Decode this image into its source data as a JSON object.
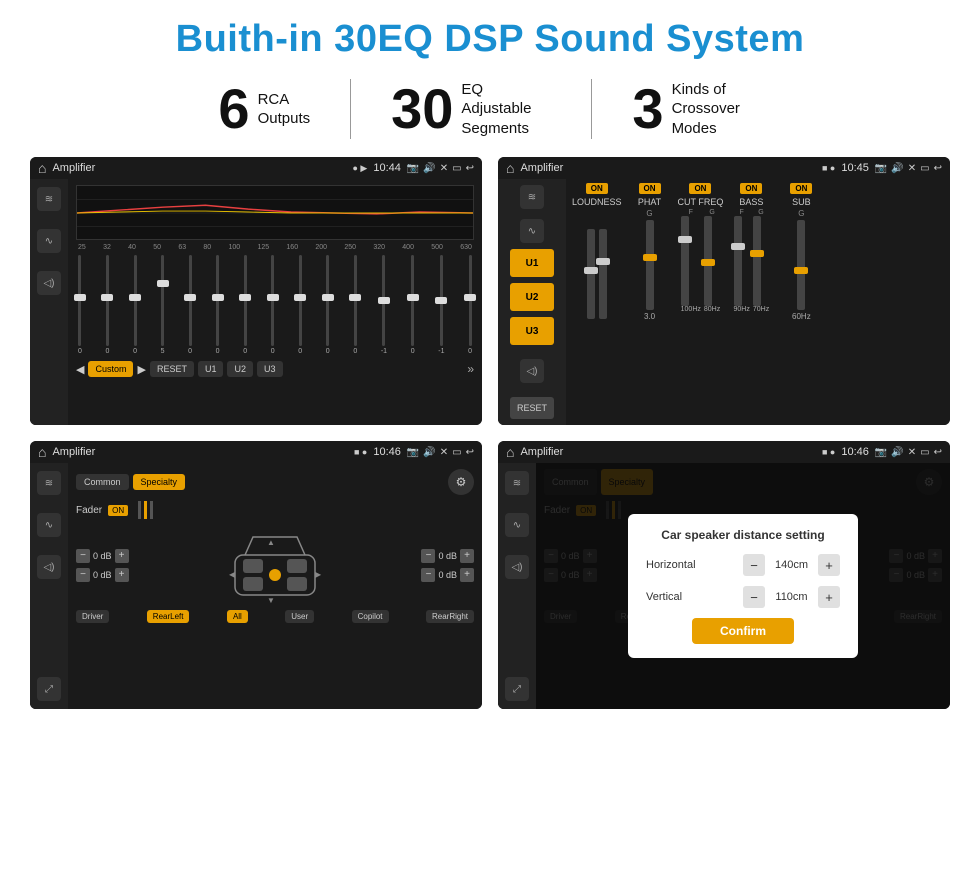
{
  "title": "Buith-in 30EQ DSP Sound System",
  "stats": [
    {
      "number": "6",
      "label": "RCA\nOutputs"
    },
    {
      "number": "30",
      "label": "EQ Adjustable\nSegments"
    },
    {
      "number": "3",
      "label": "Kinds of\nCrossover Modes"
    }
  ],
  "screens": [
    {
      "id": "screen1",
      "status_title": "Amplifier",
      "status_time": "10:44",
      "type": "eq"
    },
    {
      "id": "screen2",
      "status_title": "Amplifier",
      "status_time": "10:45",
      "type": "crossover"
    },
    {
      "id": "screen3",
      "status_title": "Amplifier",
      "status_time": "10:46",
      "type": "fader"
    },
    {
      "id": "screen4",
      "status_title": "Amplifier",
      "status_time": "10:46",
      "type": "fader_dialog"
    }
  ],
  "eq": {
    "frequencies": [
      "25",
      "32",
      "40",
      "50",
      "63",
      "80",
      "100",
      "125",
      "160",
      "200",
      "250",
      "320",
      "400",
      "500",
      "630"
    ],
    "values": [
      0,
      0,
      0,
      5,
      0,
      0,
      0,
      0,
      0,
      0,
      0,
      -1,
      0,
      -1,
      0
    ],
    "bottom_buttons": [
      "◀",
      "Custom",
      "▶",
      "RESET",
      "U1",
      "U2",
      "U3"
    ]
  },
  "crossover": {
    "u_buttons": [
      "U1",
      "U2",
      "U3"
    ],
    "columns": [
      "LOUDNESS",
      "PHAT",
      "CUT FREQ",
      "BASS",
      "SUB"
    ],
    "on_labels": [
      "ON",
      "ON",
      "ON",
      "ON",
      "ON"
    ]
  },
  "fader": {
    "tabs": [
      "Common",
      "Specialty"
    ],
    "fader_label": "Fader",
    "on_label": "ON",
    "controls": {
      "left_top_db": "0 dB",
      "left_bottom_db": "0 dB",
      "right_top_db": "0 dB",
      "right_bottom_db": "0 dB"
    },
    "bottom_buttons": [
      "Driver",
      "RearLeft",
      "All",
      "User",
      "Copilot",
      "RearRight"
    ]
  },
  "dialog": {
    "title": "Car speaker distance setting",
    "horizontal_label": "Horizontal",
    "horizontal_value": "140cm",
    "vertical_label": "Vertical",
    "vertical_value": "110cm",
    "confirm_label": "Confirm"
  },
  "colors": {
    "accent": "#e8a000",
    "title_blue": "#1a8fd1",
    "dark_bg": "#1a1a1a",
    "panel_bg": "#222"
  }
}
